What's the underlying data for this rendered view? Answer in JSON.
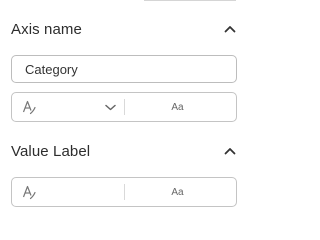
{
  "axis_name": {
    "title": "Axis name",
    "input_value": "Category",
    "font_size_label": "Aa",
    "collapse_icon": "chevron-up-icon",
    "font_icon": "font-style-icon",
    "dropdown_icon": "chevron-down-icon"
  },
  "value_label": {
    "title": "Value Label",
    "font_size_label": "Aa",
    "collapse_icon": "chevron-up-icon",
    "font_icon": "font-style-icon"
  },
  "colors": {
    "text": "#2d2d2d",
    "border": "#bdbdbd",
    "icon": "#777777"
  }
}
